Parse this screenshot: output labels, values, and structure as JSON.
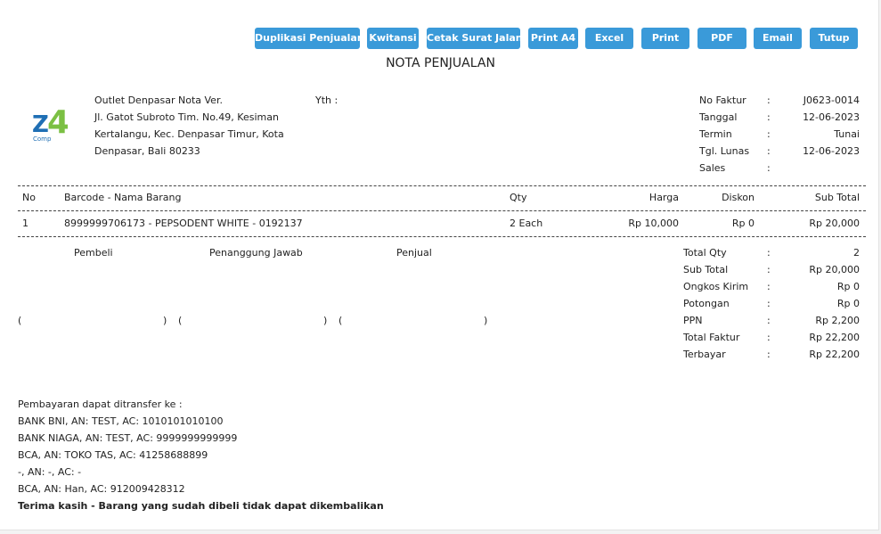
{
  "toolbar": {
    "buttons": [
      "Duplikasi Penjualan",
      "Kwitansi",
      "Cetak Surat Jalan",
      "Print A4",
      "Excel",
      "Print",
      "PDF",
      "Email",
      "Tutup"
    ]
  },
  "document_title": "NOTA PENJUALAN",
  "logo": {
    "main": "Z",
    "digit": "4",
    "sub": "Comp",
    "colors": {
      "blue": "#1f6fb4",
      "green": "#7bc043"
    }
  },
  "outlet": {
    "lines": [
      "Outlet Denpasar Nota Ver.",
      "Jl. Gatot Subroto Tim. No.49, Kesiman",
      "Kertalangu, Kec. Denpasar Timur, Kota",
      "Denpasar, Bali 80233"
    ]
  },
  "recipient_label": "Yth :",
  "invoice_info": [
    {
      "label": "No Faktur",
      "sep": ":",
      "value": "J0623-0014"
    },
    {
      "label": "Tanggal",
      "sep": ":",
      "value": "12-06-2023"
    },
    {
      "label": "Termin",
      "sep": ":",
      "value": "Tunai"
    },
    {
      "label": "Tgl. Lunas",
      "sep": ":",
      "value": "12-06-2023"
    },
    {
      "label": "Sales",
      "sep": ":",
      "value": ""
    }
  ],
  "table": {
    "headers": {
      "no": "No",
      "item": "Barcode - Nama Barang",
      "qty": "Qty",
      "price": "Harga",
      "discount": "Diskon",
      "subtotal": "Sub Total"
    },
    "rows": [
      {
        "no": "1",
        "item": "8999999706173 - PEPSODENT WHITE - 0192137",
        "qty": "2 Each",
        "price": "Rp 10,000",
        "discount": "Rp 0",
        "subtotal": "Rp 20,000"
      }
    ]
  },
  "signatures": {
    "labels": [
      "Pembeli",
      "Penanggung Jawab",
      "Penjual"
    ],
    "open": "(",
    "close": ")"
  },
  "summary": [
    {
      "label": "Total Qty",
      "sep": ":",
      "value": "2"
    },
    {
      "label": "Sub Total",
      "sep": ":",
      "value": "Rp 20,000"
    },
    {
      "label": "Ongkos Kirim",
      "sep": ":",
      "value": "Rp 0"
    },
    {
      "label": "Potongan",
      "sep": ":",
      "value": "Rp 0"
    },
    {
      "label": "PPN",
      "sep": ":",
      "value": "Rp 2,200"
    },
    {
      "label": "Total Faktur",
      "sep": ":",
      "value": "Rp 22,200"
    },
    {
      "label": "Terbayar",
      "sep": ":",
      "value": "Rp 22,200"
    }
  ],
  "payment": {
    "intro": "Pembayaran dapat ditransfer ke :",
    "accounts": [
      "BANK BNI, AN: TEST, AC: 1010101010100",
      "BANK NIAGA, AN: TEST, AC: 9999999999999",
      "BCA, AN: TOKO TAS, AC: 41258688899",
      "-, AN: -, AC: -",
      "BCA, AN: Han, AC: 912009428312"
    ],
    "thanks": "Terima kasih - Barang yang sudah dibeli tidak dapat dikembalikan"
  }
}
